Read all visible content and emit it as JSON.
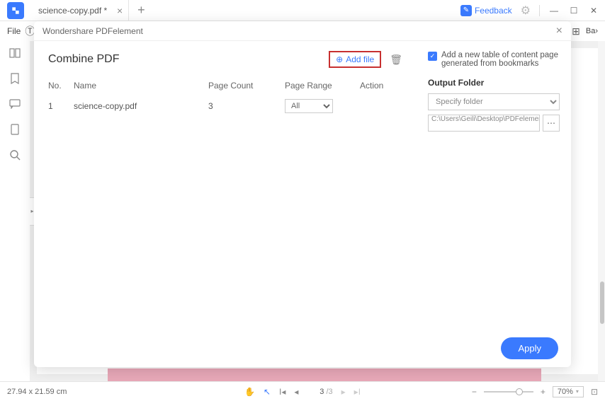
{
  "tab": {
    "name": "science-copy.pdf *"
  },
  "menubar": {
    "file": "File",
    "batch_suffix": "Ba"
  },
  "feedback": {
    "label": "Feedback"
  },
  "modal": {
    "header": "Wondershare PDFelement",
    "title": "Combine PDF",
    "add_file_label": "Add file",
    "columns": {
      "no": "No.",
      "name": "Name",
      "count": "Page Count",
      "range": "Page Range",
      "action": "Action"
    },
    "rows": [
      {
        "no": "1",
        "name": "science-copy.pdf",
        "count": "3",
        "range": "All"
      }
    ],
    "bookmark_label": "Add a new table of content page generated from bookmarks",
    "output_label": "Output Folder",
    "specify_placeholder": "Specify folder",
    "path": "C:\\Users\\Geili\\Desktop\\PDFelement\\Cc",
    "apply_label": "Apply"
  },
  "statusbar": {
    "dims": "27.94 x 21.59 cm",
    "page_current": "3",
    "page_total": "/3",
    "zoom": "70%"
  }
}
